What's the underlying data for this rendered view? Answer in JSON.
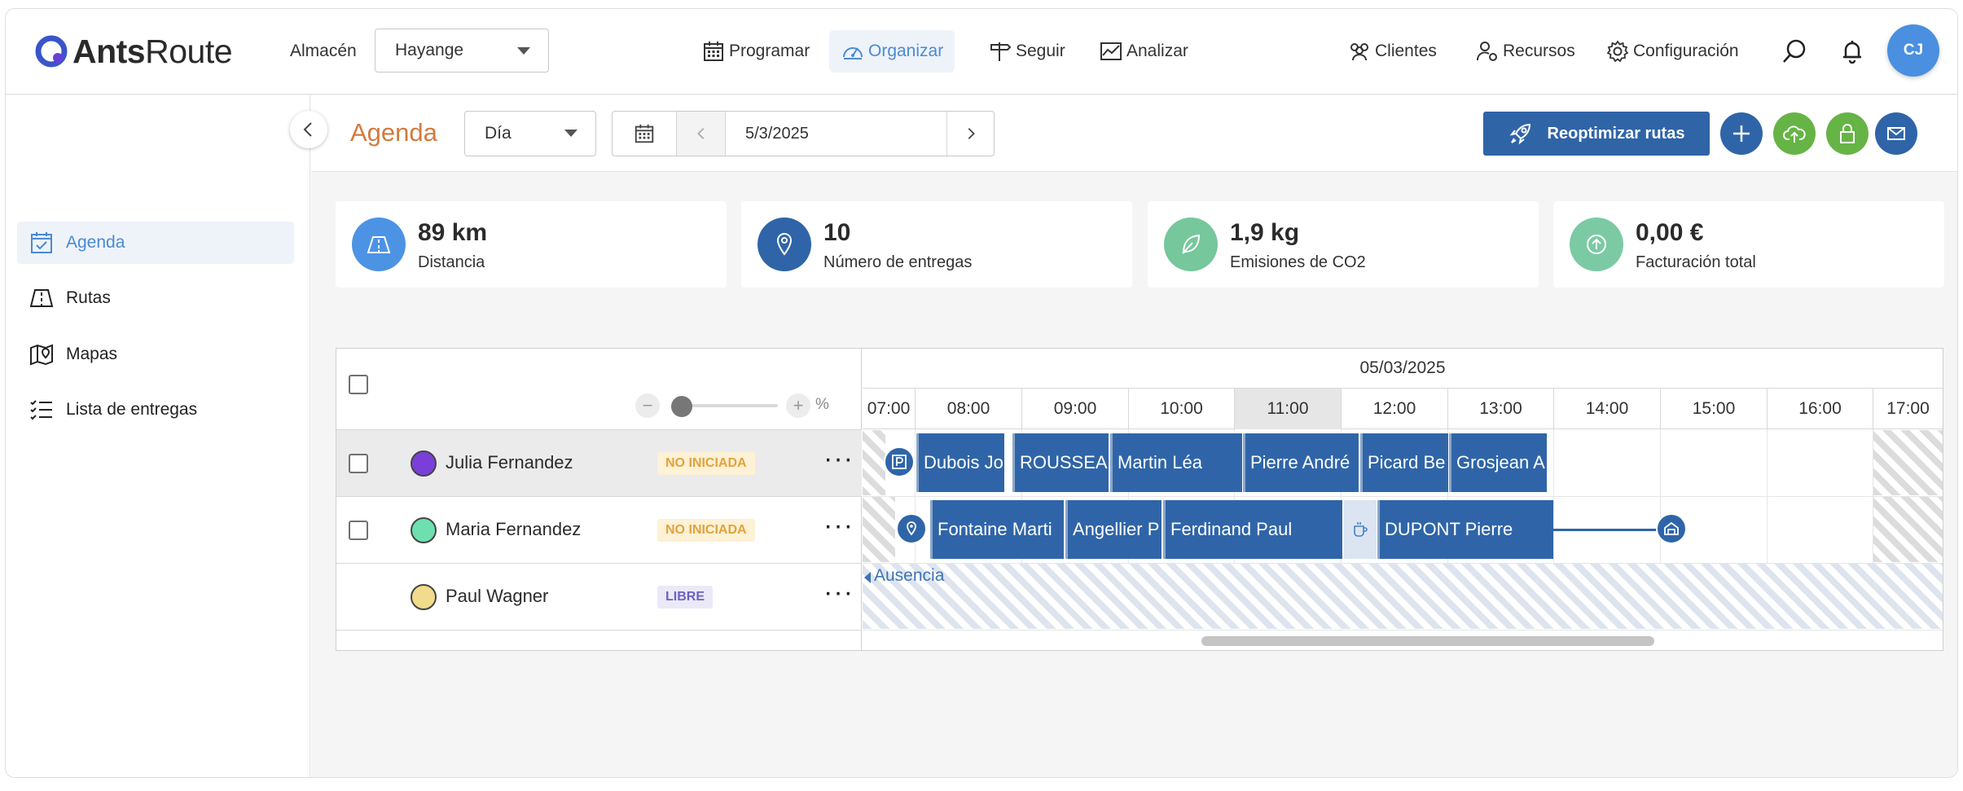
{
  "brand": {
    "name_bold": "Ants",
    "name_rest": "Route"
  },
  "header": {
    "almacen_label": "Almacén",
    "almacen_value": "Hayange",
    "nav": [
      {
        "label": "Programar",
        "icon": "calendar-icon"
      },
      {
        "label": "Organizar",
        "icon": "dashboard-gauge-icon",
        "active": true
      },
      {
        "label": "Seguir",
        "icon": "signpost-icon"
      },
      {
        "label": "Analizar",
        "icon": "chart-icon"
      }
    ],
    "right_nav": [
      {
        "label": "Clientes",
        "icon": "clients-icon"
      },
      {
        "label": "Recursos",
        "icon": "resources-icon"
      },
      {
        "label": "Configuración",
        "icon": "gear-icon"
      }
    ],
    "avatar_initials": "CJ"
  },
  "sidebar": {
    "items": [
      {
        "label": "Agenda",
        "icon": "calendar-check-icon",
        "active": true
      },
      {
        "label": "Rutas",
        "icon": "road-icon"
      },
      {
        "label": "Mapas",
        "icon": "map-icon"
      },
      {
        "label": "Lista de entregas",
        "icon": "list-icon"
      }
    ]
  },
  "toolbar": {
    "title": "Agenda",
    "view_value": "Día",
    "date_value": "5/3/2025",
    "reoptimize_label": "Reoptimizar rutas"
  },
  "kpis": [
    {
      "value": "89 km",
      "label": "Distancia",
      "color": "#4d93e4"
    },
    {
      "value": "10",
      "label": "Número de entregas",
      "color": "#2f65a8"
    },
    {
      "value": "1,9 kg",
      "label": "Emisiones de CO2",
      "color": "#76c79c"
    },
    {
      "value": "0,00 €",
      "label": "Facturación total",
      "color": "#7bcaa4"
    }
  ],
  "gantt": {
    "day_label": "05/03/2025",
    "zoom_unit": "%",
    "hours": [
      "07:00",
      "08:00",
      "09:00",
      "10:00",
      "11:00",
      "12:00",
      "13:00",
      "14:00",
      "15:00",
      "16:00",
      "17:00"
    ],
    "resources": [
      {
        "name": "Julia Fernandez",
        "status": "NO INICIADA",
        "color": "#7b3fd9"
      },
      {
        "name": "Maria Fernandez",
        "status": "NO INICIADA",
        "color": "#6ee0b0"
      },
      {
        "name": "Paul Wagner",
        "status": "LIBRE",
        "color": "#f0dc8a"
      }
    ],
    "row1_tasks": [
      "Dubois Jo",
      "ROUSSEAU",
      "Martin Léa",
      "Pierre André",
      "Picard Be",
      "Grosjean A"
    ],
    "row2_tasks": [
      "Fontaine Marti",
      "Angellier P",
      "Ferdinand Paul",
      "DUPONT Pierre"
    ],
    "absence_label": "Ausencia"
  }
}
